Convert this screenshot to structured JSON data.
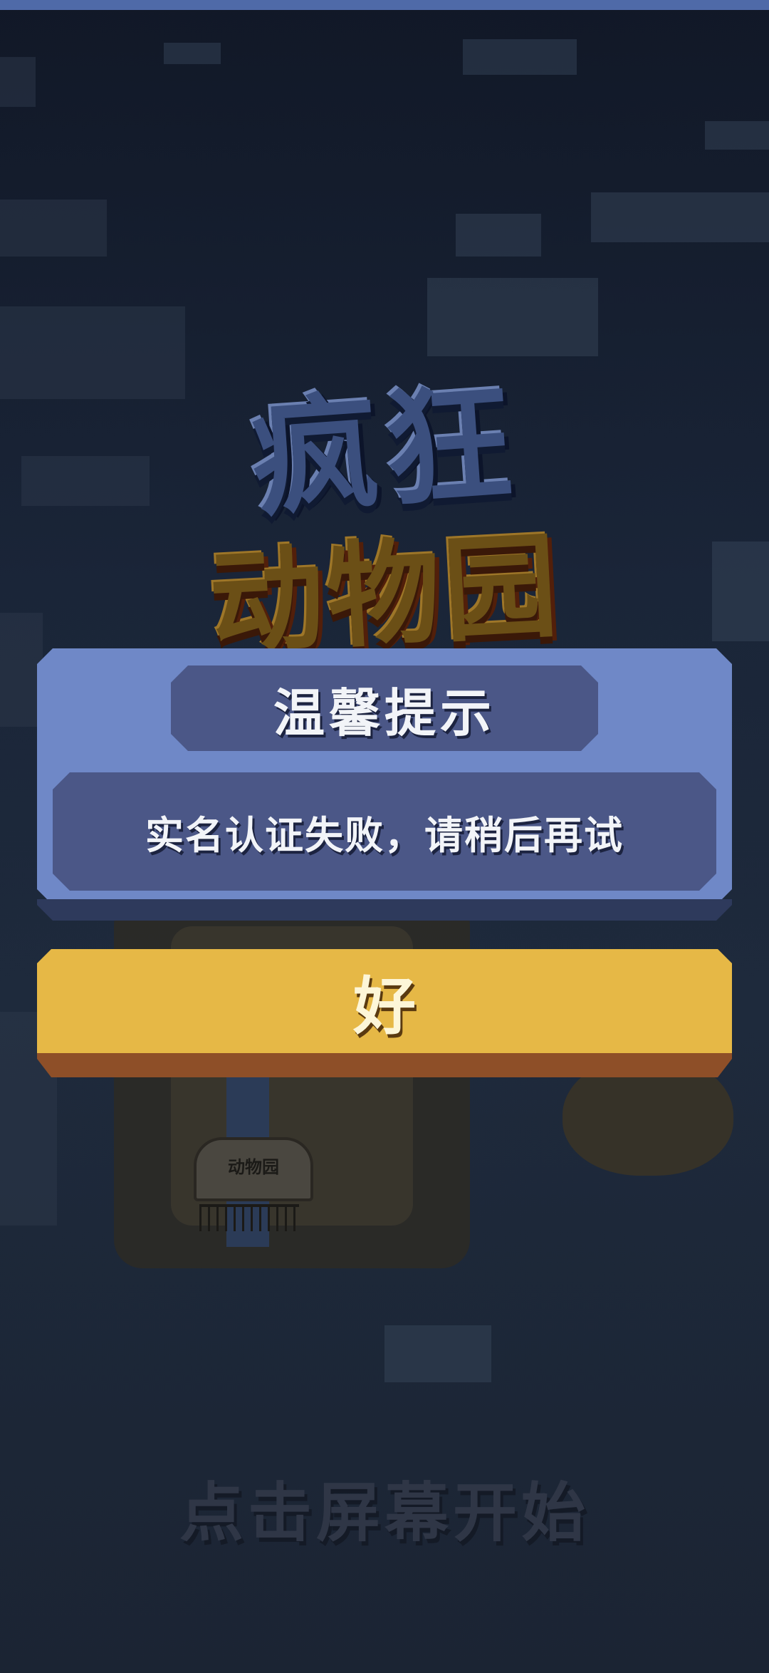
{
  "colors": {
    "dialog_bg": "#6f88c7",
    "dialog_panel": "#4b5787",
    "button_face": "#e6b846",
    "button_base": "#8e4f28",
    "background": "#1a2538"
  },
  "logo": {
    "line1": "疯狂",
    "line2": "动物园"
  },
  "scene": {
    "sign_text": "动物园"
  },
  "dialog": {
    "title": "温馨提示",
    "message": "实名认证失败，请稍后再试",
    "ok_label": "好"
  },
  "footer": {
    "tap_to_start": "点击屏幕开始"
  }
}
